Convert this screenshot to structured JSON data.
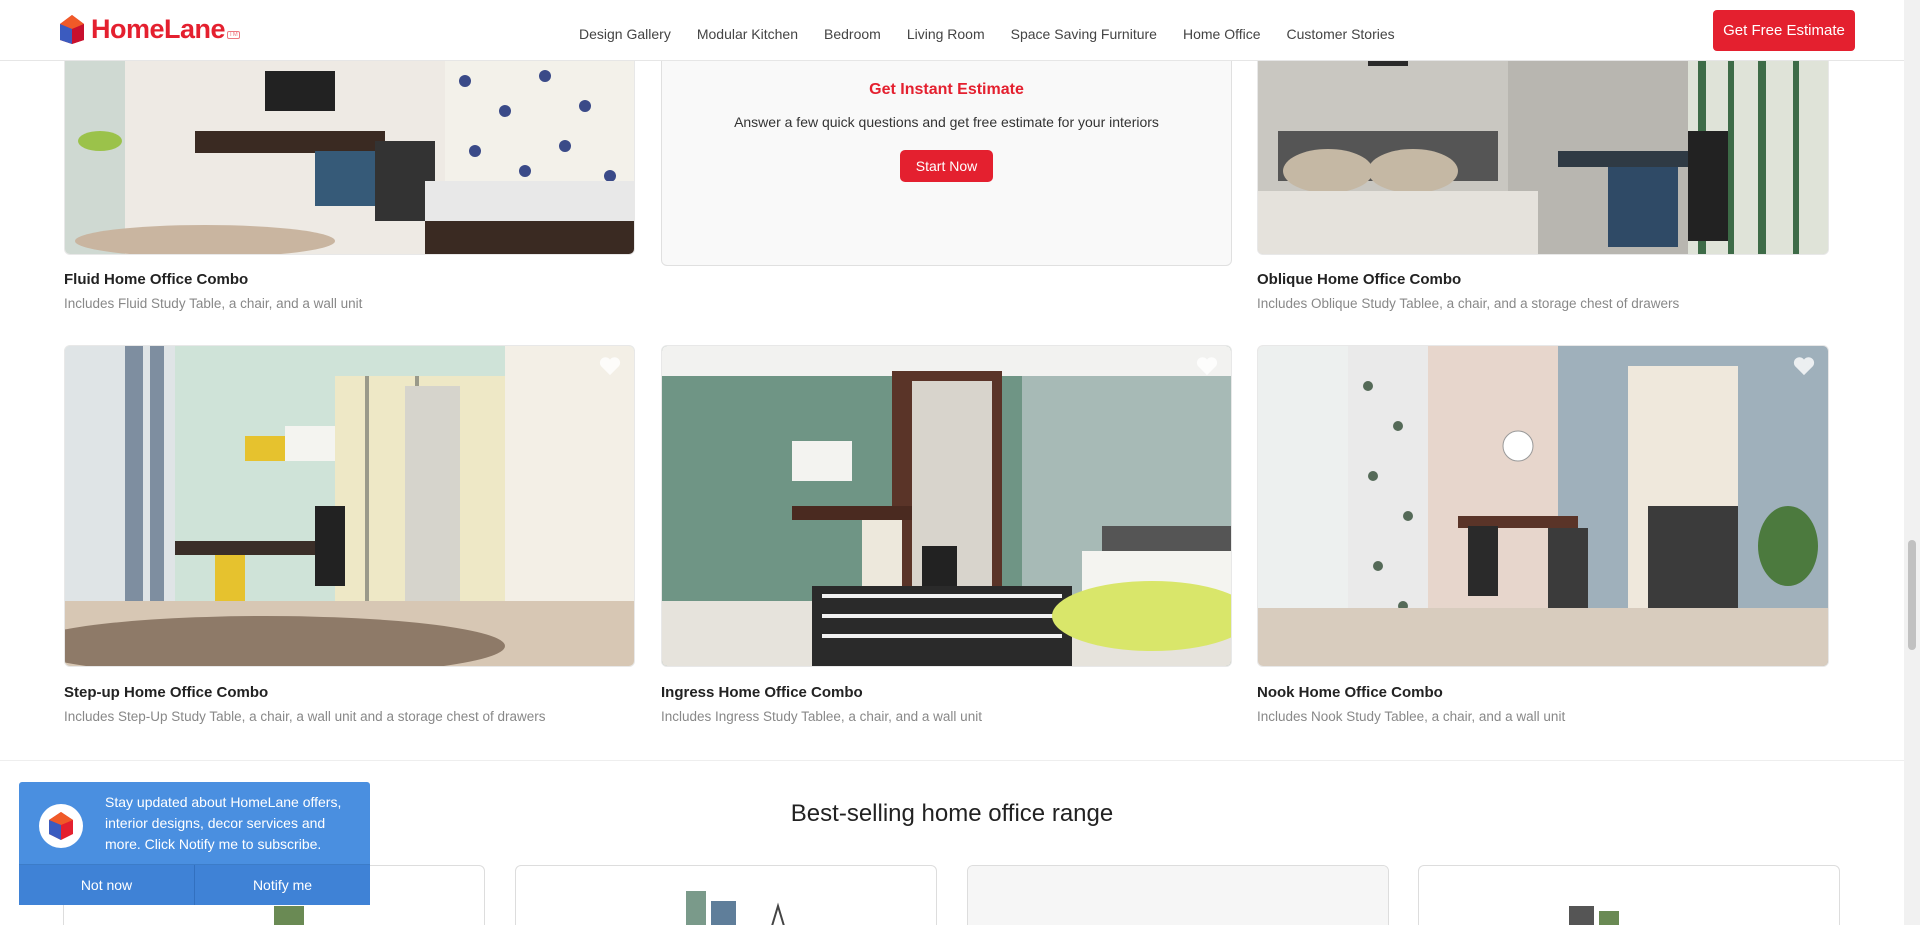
{
  "header": {
    "logo_text": "HomeLane",
    "logo_tm": "TM",
    "nav": [
      "Design Gallery",
      "Modular Kitchen",
      "Bedroom",
      "Living Room",
      "Space Saving Furniture",
      "Home Office",
      "Customer Stories"
    ],
    "cta": "Get Free Estimate"
  },
  "estimate": {
    "title": "Get Instant Estimate",
    "subtitle": "Answer a few quick questions and get free estimate for your interiors",
    "button": "Start Now"
  },
  "products": [
    {
      "title": "Fluid Home Office Combo",
      "desc": "Includes Fluid Study Table, a chair, and a wall unit"
    },
    {
      "title": "Oblique Home Office Combo",
      "desc": "Includes Oblique Study Tablee, a chair, and a storage chest of drawers"
    },
    {
      "title": "Step-up Home Office Combo",
      "desc": "Includes Step-Up Study Table, a chair, a wall unit and a storage chest of drawers"
    },
    {
      "title": "Ingress Home Office Combo",
      "desc": "Includes Ingress Study Tablee, a chair, and a wall unit"
    },
    {
      "title": "Nook Home Office Combo",
      "desc": "Includes Nook Study Tablee, a chair, and a wall unit"
    }
  ],
  "section": {
    "title": "Best-selling home office range"
  },
  "notification": {
    "text": "Stay updated about HomeLane offers, interior designs, decor services and more. Click Notify me to subscribe.",
    "not_now": "Not now",
    "notify_me": "Notify me"
  },
  "colors": {
    "brand": "#e4202f",
    "notify": "#4a8fe0"
  }
}
